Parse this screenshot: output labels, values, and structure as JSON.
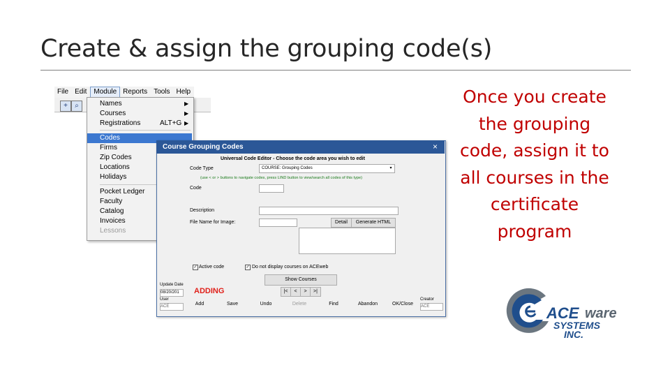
{
  "slide": {
    "title": "Create & assign the grouping code(s)",
    "note": "Once you create the grouping code, assign it to all courses in the certificate program"
  },
  "menubar": [
    "File",
    "Edit",
    "Module",
    "Reports",
    "Tools",
    "Help"
  ],
  "module_menu": {
    "items": [
      {
        "label": "Names",
        "shortcut": "",
        "submenu": true
      },
      {
        "label": "Courses",
        "shortcut": "",
        "submenu": true
      },
      {
        "label": "Registrations",
        "shortcut": "ALT+G",
        "submenu": true
      },
      {
        "label": "Codes",
        "shortcut": "",
        "submenu": false
      },
      {
        "label": "Firms",
        "shortcut": "",
        "submenu": false
      },
      {
        "label": "Zip Codes",
        "shortcut": "",
        "submenu": false
      },
      {
        "label": "Locations",
        "shortcut": "",
        "submenu": false
      },
      {
        "label": "Holidays",
        "shortcut": "",
        "submenu": false
      },
      {
        "label": "Pocket Ledger",
        "shortcut": "",
        "submenu": false
      },
      {
        "label": "Faculty",
        "shortcut": "",
        "submenu": false
      },
      {
        "label": "Catalog",
        "shortcut": "",
        "submenu": false
      },
      {
        "label": "Invoices",
        "shortcut": "",
        "submenu": false
      },
      {
        "label": "Lessons",
        "shortcut": "",
        "submenu": false
      }
    ],
    "highlighted": "Codes",
    "disabled": "Lessons"
  },
  "dialog": {
    "title": "Course Grouping Codes",
    "close": "×",
    "heading": "Universal Code Editor - Choose the code area you wish to edit",
    "code_type_label": "Code Type",
    "code_type_value": "COURSE: Grouping Codes",
    "hint": "(use < or > buttons to navigate codes, press LIND button to view/search all codes of this type)",
    "code_label": "Code",
    "description_label": "Description",
    "filename_label": "File Name for Image:",
    "detail_button": "Detail",
    "generate_html_button": "Generate HTML",
    "active_code_label": "Active code",
    "active_code_checked": true,
    "dont_display_label": "Do not display courses on ACEweb",
    "dont_display_checked": true,
    "show_courses_button": "Show Courses",
    "nav_buttons": [
      "|<",
      "<",
      ">",
      ">|"
    ],
    "status": "ADDING",
    "update_date_label": "Update Date",
    "update_date_value": "08/20/201",
    "user_label": "User",
    "user_value": "ACE",
    "creator_label": "Creator",
    "creator_value": "ACE",
    "footer_buttons": [
      "Add",
      "Save",
      "Undo",
      "Delete",
      "Find",
      "Abandon",
      "OK/Close"
    ]
  },
  "logo": {
    "ace": "ACE",
    "ware": "ware",
    "systems": "SYSTEMS",
    "inc": "INC.",
    "colors": {
      "blue": "#1f4e8c",
      "gray": "#5a6570"
    }
  }
}
